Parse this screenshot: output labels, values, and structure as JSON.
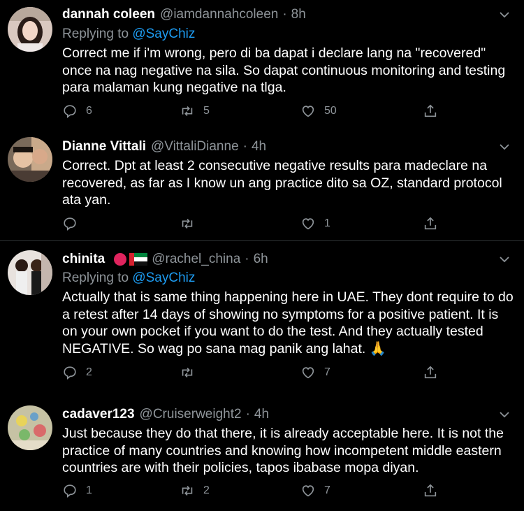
{
  "tweets": [
    {
      "name": "dannah coleen",
      "handle": "@iamdannahcoleen",
      "time": "8h",
      "replying_to": "Replying to",
      "mention": "@SayChiz",
      "text": "Correct me if i'm wrong, pero di ba dapat i declare lang na \"recovered\" once na nag negative na sila. So dapat continuous monitoring and testing para malaman kung negative na tlga.",
      "replies": "6",
      "retweets": "5",
      "likes": "50"
    },
    {
      "name": "Dianne Vittali",
      "handle": "@VittaliDianne",
      "time": "4h",
      "text": "Correct. Dpt at least 2 consecutive negative results para madeclare na recovered, as far as I know un ang practice dito sa OZ, standard protocol ata yan.",
      "replies": "",
      "retweets": "",
      "likes": "1"
    },
    {
      "name": "chinita",
      "handle": "@rachel_china",
      "time": "6h",
      "replying_to": "Replying to",
      "mention": "@SayChiz",
      "text": "Actually that is same thing happening here in UAE. They dont require to do a retest after 14 days of showing no symptoms for a positive patient. It is on your own pocket if you want to do the test. And they actually tested NEGATIVE. So wag po sana mag panik ang lahat. 🙏",
      "replies": "2",
      "retweets": "",
      "likes": "7"
    },
    {
      "name": "cadaver123",
      "handle": "@Cruiserweight2",
      "time": "4h",
      "text": "Just because they do that there, it is already acceptable here. It is not the practice of many countries and knowing how incompetent middle eastern countries are with their policies, tapos ibabase mopa diyan.",
      "replies": "1",
      "retweets": "2",
      "likes": "7"
    }
  ],
  "separator": "·",
  "colors": {
    "background": "#000000",
    "text": "#ffffff",
    "secondary": "#8e9499",
    "link": "#1d9bf0"
  }
}
